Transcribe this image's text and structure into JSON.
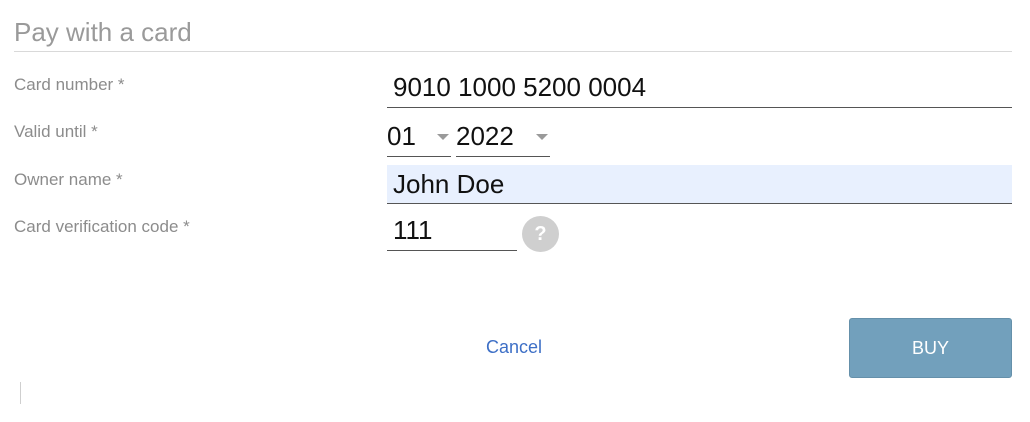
{
  "form": {
    "title": "Pay with a card",
    "card_number": {
      "label": "Card number *",
      "value": "9010 1000 5200 0004"
    },
    "valid_until": {
      "label": "Valid until *",
      "month": "01",
      "year": "2022"
    },
    "owner_name": {
      "label": "Owner name *",
      "value": "John Doe"
    },
    "cvc": {
      "label": "Card verification code *",
      "value": "111",
      "help": "?"
    }
  },
  "actions": {
    "cancel_label": "Cancel",
    "buy_label": "BUY"
  },
  "colors": {
    "accent_link": "#3d6fc6",
    "buy_button": "#72a0bc",
    "autofill_highlight": "#e8f0fe"
  }
}
